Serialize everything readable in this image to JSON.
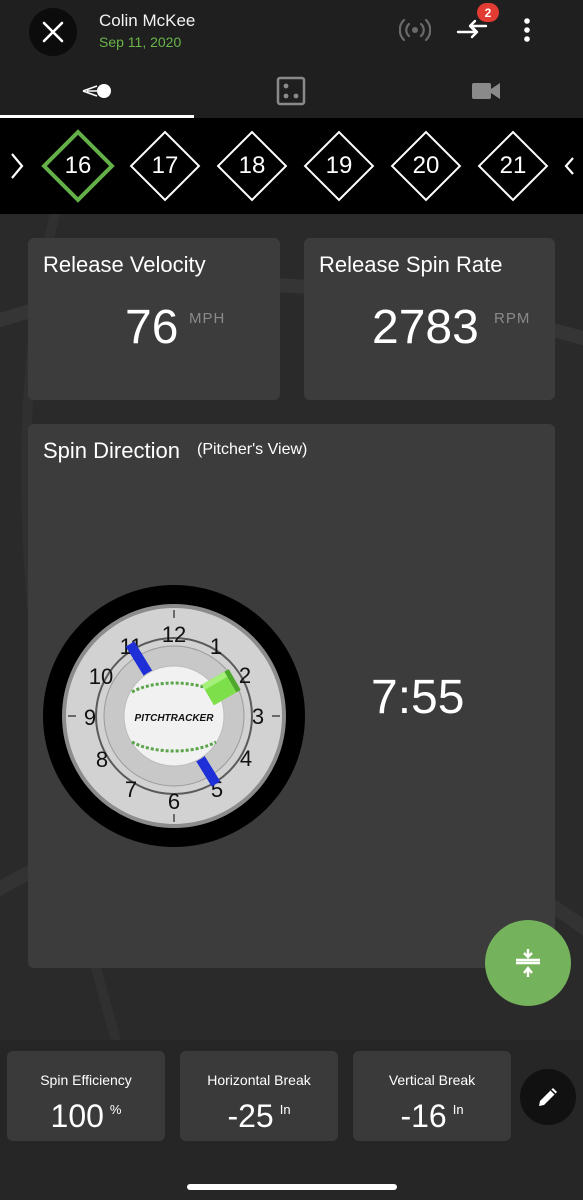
{
  "header": {
    "user_name": "Colin McKee",
    "date": "Sep 11, 2020",
    "sync_badge_count": "2",
    "icons": [
      "close-icon",
      "broadcast-icon",
      "sync-arrows-icon",
      "more-vert-icon"
    ]
  },
  "tabs": [
    {
      "name": "pitch-tab",
      "icon": "ball-motion-icon",
      "active": true
    },
    {
      "name": "dice-tab",
      "icon": "dice-icon",
      "active": false
    },
    {
      "name": "video-tab",
      "icon": "video-camera-icon",
      "active": false
    }
  ],
  "pitches": [
    "16",
    "17",
    "18",
    "19",
    "20",
    "21"
  ],
  "selected_pitch": "16",
  "release_velocity": {
    "title": "Release Velocity",
    "value": "76",
    "unit": "MPH"
  },
  "release_spin_rate": {
    "title": "Release Spin Rate",
    "value": "2783",
    "unit": "RPM"
  },
  "spin_direction": {
    "title": "Spin Direction",
    "subtitle": "(Pitcher's View)",
    "clock_time": "7:55",
    "ball_logo": "PITCHTRACKER",
    "clock_numbers": [
      "12",
      "1",
      "2",
      "3",
      "4",
      "5",
      "6",
      "7",
      "8",
      "9",
      "10",
      "11"
    ]
  },
  "stats": {
    "spin_efficiency": {
      "label": "Spin Efficiency",
      "value": "100",
      "unit": "%"
    },
    "horizontal_break": {
      "label": "Horizontal Break",
      "value": "-25",
      "unit": "In"
    },
    "vertical_break": {
      "label": "Vertical Break",
      "value": "-16",
      "unit": "In"
    }
  },
  "colors": {
    "accent_green": "#69b54a",
    "fab_green": "#74b25c",
    "badge_red": "#e23b32",
    "axis_blue": "#1e2fd8",
    "axis_green": "#7de04a"
  }
}
